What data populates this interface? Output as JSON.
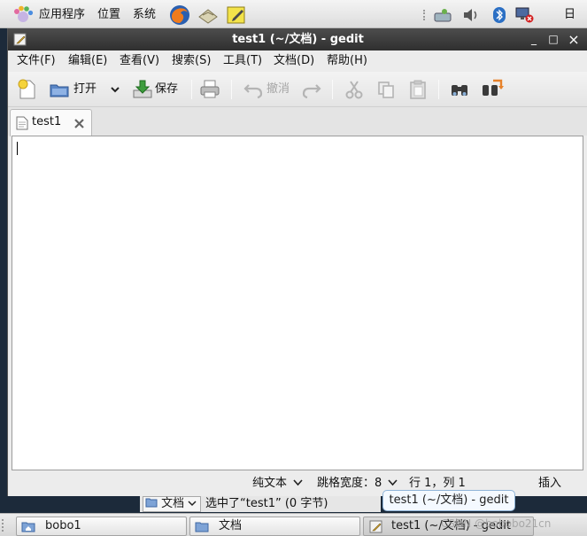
{
  "top_panel": {
    "menus": [
      "应用程序",
      "位置",
      "系统"
    ],
    "clock": "日"
  },
  "window": {
    "title": "test1 (~/文档) - gedit",
    "controls": {
      "minimize": "_",
      "maximize": "□",
      "close": "×"
    }
  },
  "menubar": {
    "items": [
      "文件(F)",
      "编辑(E)",
      "查看(V)",
      "搜索(S)",
      "工具(T)",
      "文档(D)",
      "帮助(H)"
    ]
  },
  "toolbar": {
    "open_label": "打开",
    "save_label": "保存",
    "undo_label": "撤消"
  },
  "tab": {
    "label": "test1"
  },
  "statusbar": {
    "language": "纯文本",
    "tab_width_label": "跳格宽度：",
    "tab_width_value": "8",
    "position": "行 1，列 1",
    "mode": "插入"
  },
  "background_window": {
    "location": "文档",
    "status": "选中了“test1” (0 字节)"
  },
  "taskbar": {
    "items": [
      "bobo1",
      "文档",
      "test1 (~/文档) - gedit"
    ]
  },
  "tooltip": "test1 (~/文档) - gedit",
  "watermark": "CSDN @bobobo21cn"
}
